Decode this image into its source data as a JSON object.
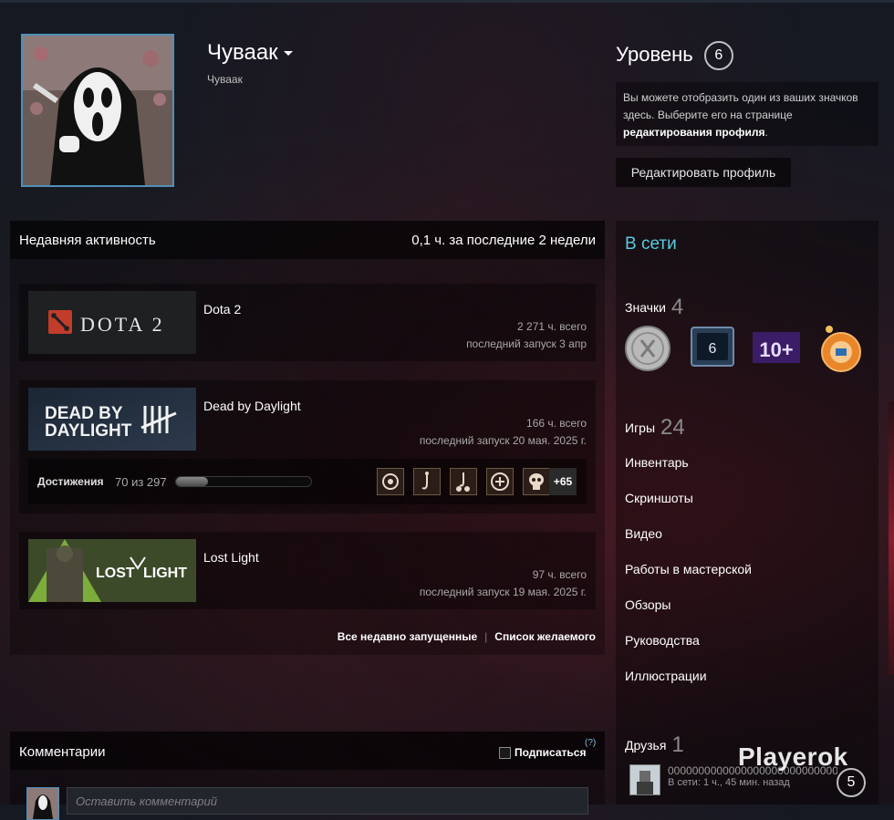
{
  "profile": {
    "persona_name": "Чуваак",
    "real_name": "Чуваак"
  },
  "level": {
    "label": "Уровень",
    "value": "6",
    "badge_hint_part1": "Вы можете отобразить один из ваших значков здесь. Выберите его на странице ",
    "badge_hint_link": "редактирования профиля",
    "badge_hint_part2": ".",
    "edit_button": "Редактировать профиль"
  },
  "recent": {
    "title": "Недавняя активность",
    "hours_summary": "0,1 ч. за последние 2 недели",
    "games": [
      {
        "name": "Dota 2",
        "capsule_text": "DOTA 2",
        "hours": "2 271 ч. всего",
        "last": "последний запуск 3 апр"
      },
      {
        "name": "Dead by Daylight",
        "capsule_text_1": "DEAD BY",
        "capsule_text_2": "DAYLIGHT",
        "hours": "166 ч. всего",
        "last": "последний запуск 20 мая. 2025 г.",
        "achievements": {
          "label": "Достижения",
          "count": "70 из 297",
          "progress": 0.236,
          "more": "+65"
        }
      },
      {
        "name": "Lost Light",
        "capsule_text_1": "LOST",
        "capsule_text_2": "LIGHT",
        "hours": "97 ч. всего",
        "last": "последний запуск 19 мая. 2025 г."
      }
    ],
    "link_all": "Все недавно запущенные",
    "link_wishlist": "Список желаемого"
  },
  "comments": {
    "title": "Комментарии",
    "subscribe": "Подписаться",
    "help": "(?)",
    "placeholder": "Оставить комментарий"
  },
  "sidebar": {
    "status": "В сети",
    "badges_label": "Значки",
    "badges_count": "4",
    "badge6_text": "6",
    "badge10_text": "10+",
    "games_label": "Игры",
    "games_count": "24",
    "links": [
      "Инвентарь",
      "Скриншоты",
      "Видео",
      "Работы в мастерской",
      "Обзоры",
      "Руководства",
      "Иллюстрации"
    ],
    "friends_label": "Друзья",
    "friends_count": "1",
    "friend_name": "0000000000000000000000000000000000",
    "friend_status": "В сети: 1 ч., 45 мин. назад",
    "friend_level": "5"
  },
  "watermark": "Playerok",
  "colors": {
    "online": "#57cbde",
    "avatar_border": "#4f8fb8",
    "accent_orange": "#e8862a"
  }
}
